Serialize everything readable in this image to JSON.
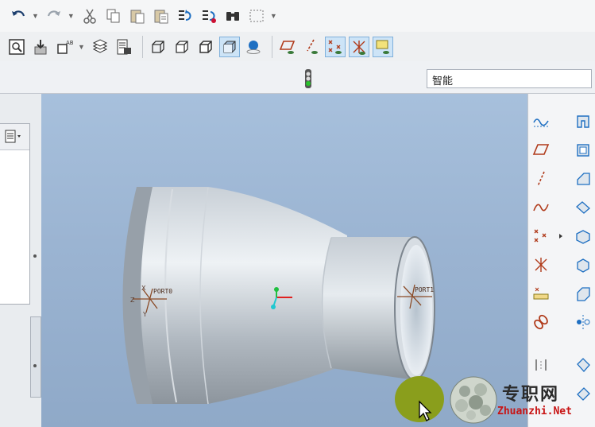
{
  "search": {
    "filter_value": "智能"
  },
  "viewport": {
    "port_labels": [
      "PORT0",
      "PORT1"
    ],
    "csys_axis_label_x": "X",
    "csys_axis_label_y": "Y",
    "csys_axis_label_z": "Z"
  },
  "toolbar_icons": {
    "row1": [
      "undo-icon",
      "redo-icon",
      "cut-icon",
      "copy-icon",
      "paste-icon",
      "paste-special-icon",
      "regenerate-icon",
      "regenerate-manager-icon",
      "find-icon",
      "select-box-icon"
    ],
    "row2": [
      "repaint-icon",
      "zoom-icon",
      "saved-views-icon",
      "layers-icon",
      "model-tree-icon",
      "wireframe-icon",
      "hidden-line-icon",
      "no-hidden-icon",
      "shading-icon",
      "spin-center-icon",
      "datum-planes-icon",
      "datum-axes-icon",
      "datum-points-icon",
      "csys-icon",
      "annotation-icon"
    ]
  },
  "colors": {
    "accent": "#1e6fc2",
    "active_bg": "#cde4f7",
    "model": "#b4bcc4"
  },
  "watermark": {
    "title": "专职网",
    "url": "Zhuanzhi.Net"
  }
}
